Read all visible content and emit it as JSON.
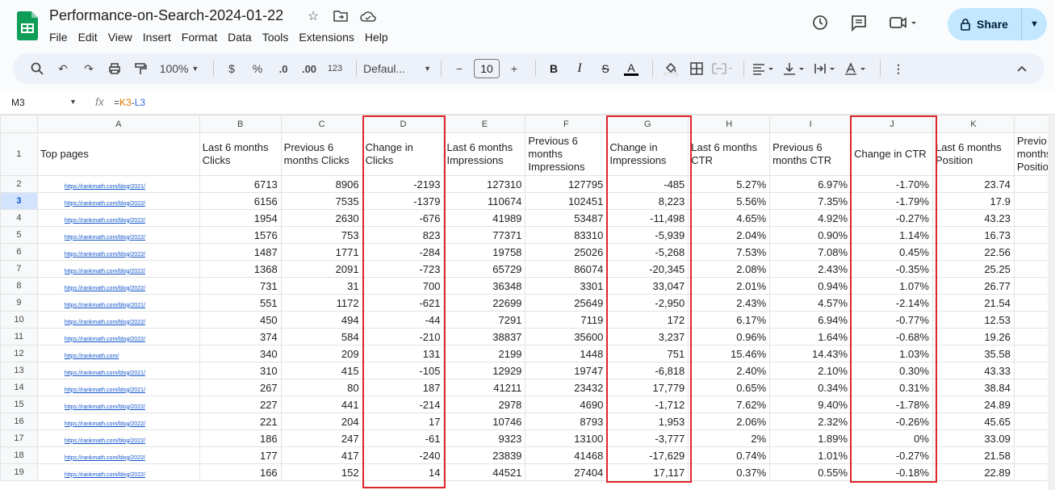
{
  "app": {
    "title": "Performance-on-Search-2024-01-22",
    "menu": [
      "File",
      "Edit",
      "View",
      "Insert",
      "Format",
      "Data",
      "Tools",
      "Extensions",
      "Help"
    ],
    "share_label": "Share"
  },
  "toolbar": {
    "zoom": "100%",
    "currency": "$",
    "percent": "%",
    "dec_decrease": ".0",
    "dec_increase": ".00",
    "number_format": "123",
    "font": "Defaul...",
    "font_size": "10"
  },
  "formula_bar": {
    "cell_ref": "M3",
    "formula_prefix": "=",
    "ref1": "K3",
    "op": "-",
    "ref2": "L3"
  },
  "columns": [
    "A",
    "B",
    "C",
    "D",
    "E",
    "F",
    "G",
    "H",
    "I",
    "J",
    "K"
  ],
  "headers": [
    "Top pages",
    "Last 6 months Clicks",
    "Previous 6 months Clicks",
    "Change in Clicks",
    "Last 6 months Impressions",
    "Previous 6 months Impressions",
    "Change in Impressions",
    "Last 6 months CTR",
    "Previous 6 months CTR",
    "Change in CTR",
    "Last 6 months Position",
    "Previo months Positio"
  ],
  "row_numbers": [
    "1",
    "2",
    "3",
    "4",
    "5",
    "6",
    "7",
    "8",
    "9",
    "10",
    "11",
    "12",
    "13",
    "14",
    "15",
    "16",
    "17",
    "18",
    "19"
  ],
  "rows": [
    {
      "url": "https://rankmath.com/blog/2021/",
      "b": "6713",
      "c": "8906",
      "d": "-2193",
      "e": "127310",
      "f": "127795",
      "g": "-485",
      "h": "5.27%",
      "i": "6.97%",
      "j": "-1.70%",
      "k": "23.74"
    },
    {
      "url": "https://rankmath.com/blog/2022/",
      "b": "6156",
      "c": "7535",
      "d": "-1379",
      "e": "110674",
      "f": "102451",
      "g": "8,223",
      "h": "5.56%",
      "i": "7.35%",
      "j": "-1.79%",
      "k": "17.9"
    },
    {
      "url": "https://rankmath.com/blog/2022/",
      "b": "1954",
      "c": "2630",
      "d": "-676",
      "e": "41989",
      "f": "53487",
      "g": "-11,498",
      "h": "4.65%",
      "i": "4.92%",
      "j": "-0.27%",
      "k": "43.23"
    },
    {
      "url": "https://rankmath.com/blog/2022/",
      "b": "1576",
      "c": "753",
      "d": "823",
      "e": "77371",
      "f": "83310",
      "g": "-5,939",
      "h": "2.04%",
      "i": "0.90%",
      "j": "1.14%",
      "k": "16.73"
    },
    {
      "url": "https://rankmath.com/blog/2022/",
      "b": "1487",
      "c": "1771",
      "d": "-284",
      "e": "19758",
      "f": "25026",
      "g": "-5,268",
      "h": "7.53%",
      "i": "7.08%",
      "j": "0.45%",
      "k": "22.56"
    },
    {
      "url": "https://rankmath.com/blog/2022/",
      "b": "1368",
      "c": "2091",
      "d": "-723",
      "e": "65729",
      "f": "86074",
      "g": "-20,345",
      "h": "2.08%",
      "i": "2.43%",
      "j": "-0.35%",
      "k": "25.25"
    },
    {
      "url": "https://rankmath.com/blog/2022/",
      "b": "731",
      "c": "31",
      "d": "700",
      "e": "36348",
      "f": "3301",
      "g": "33,047",
      "h": "2.01%",
      "i": "0.94%",
      "j": "1.07%",
      "k": "26.77"
    },
    {
      "url": "https://rankmath.com/blog/2021/",
      "b": "551",
      "c": "1172",
      "d": "-621",
      "e": "22699",
      "f": "25649",
      "g": "-2,950",
      "h": "2.43%",
      "i": "4.57%",
      "j": "-2.14%",
      "k": "21.54"
    },
    {
      "url": "https://rankmath.com/blog/2022/",
      "b": "450",
      "c": "494",
      "d": "-44",
      "e": "7291",
      "f": "7119",
      "g": "172",
      "h": "6.17%",
      "i": "6.94%",
      "j": "-0.77%",
      "k": "12.53"
    },
    {
      "url": "https://rankmath.com/blog/2022/",
      "b": "374",
      "c": "584",
      "d": "-210",
      "e": "38837",
      "f": "35600",
      "g": "3,237",
      "h": "0.96%",
      "i": "1.64%",
      "j": "-0.68%",
      "k": "19.26"
    },
    {
      "url": "https://rankmath.com/",
      "b": "340",
      "c": "209",
      "d": "131",
      "e": "2199",
      "f": "1448",
      "g": "751",
      "h": "15.46%",
      "i": "14.43%",
      "j": "1.03%",
      "k": "35.58"
    },
    {
      "url": "https://rankmath.com/blog/2021/",
      "b": "310",
      "c": "415",
      "d": "-105",
      "e": "12929",
      "f": "19747",
      "g": "-6,818",
      "h": "2.40%",
      "i": "2.10%",
      "j": "0.30%",
      "k": "43.33"
    },
    {
      "url": "https://rankmath.com/blog/2021/",
      "b": "267",
      "c": "80",
      "d": "187",
      "e": "41211",
      "f": "23432",
      "g": "17,779",
      "h": "0.65%",
      "i": "0.34%",
      "j": "0.31%",
      "k": "38.84"
    },
    {
      "url": "https://rankmath.com/blog/2022/",
      "b": "227",
      "c": "441",
      "d": "-214",
      "e": "2978",
      "f": "4690",
      "g": "-1,712",
      "h": "7.62%",
      "i": "9.40%",
      "j": "-1.78%",
      "k": "24.89"
    },
    {
      "url": "https://rankmath.com/blog/2022/",
      "b": "221",
      "c": "204",
      "d": "17",
      "e": "10746",
      "f": "8793",
      "g": "1,953",
      "h": "2.06%",
      "i": "2.32%",
      "j": "-0.26%",
      "k": "45.65"
    },
    {
      "url": "https://rankmath.com/blog/2022/",
      "b": "186",
      "c": "247",
      "d": "-61",
      "e": "9323",
      "f": "13100",
      "g": "-3,777",
      "h": "2%",
      "i": "1.89%",
      "j": "0%",
      "k": "33.09"
    },
    {
      "url": "https://rankmath.com/blog/2022/",
      "b": "177",
      "c": "417",
      "d": "-240",
      "e": "23839",
      "f": "41468",
      "g": "-17,629",
      "h": "0.74%",
      "i": "1.01%",
      "j": "-0.27%",
      "k": "21.58"
    },
    {
      "url": "https://rankmath.com/blog/2022/",
      "b": "166",
      "c": "152",
      "d": "14",
      "e": "44521",
      "f": "27404",
      "g": "17,117",
      "h": "0.37%",
      "i": "0.55%",
      "j": "-0.18%",
      "k": "22.89"
    }
  ]
}
